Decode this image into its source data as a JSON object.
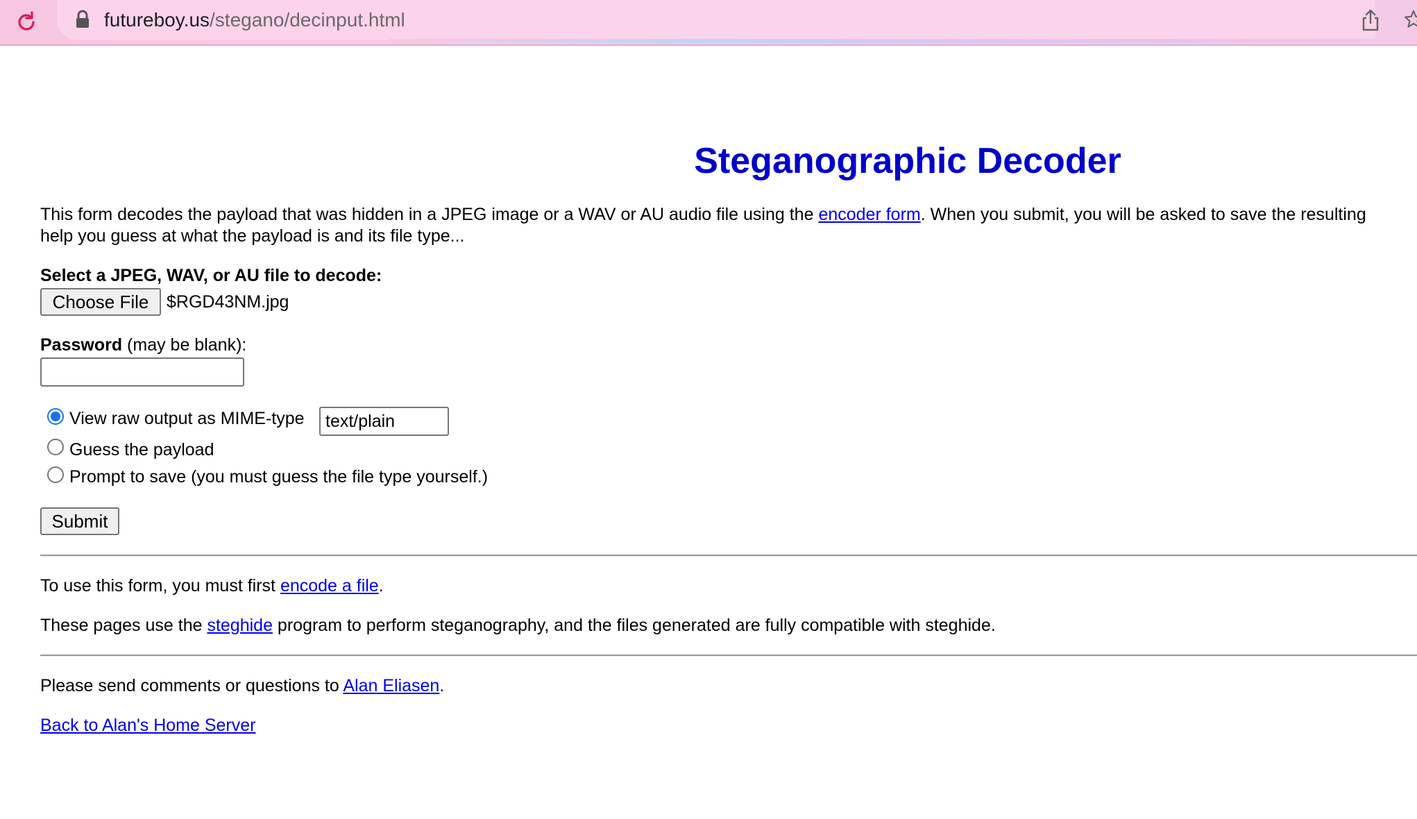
{
  "browser": {
    "url_host": "futureboy.us",
    "url_path": "/stegano/decinput.html"
  },
  "page": {
    "title": "Steganographic Decoder",
    "intro_part1": "This form decodes the payload that was hidden in a JPEG image or a WAV or AU audio file using the ",
    "intro_link": "encoder form",
    "intro_part2": ". When you submit, you will be asked to save the resulting",
    "intro_line2": "help you guess at what the payload is and its file type...",
    "file_label": "Select a JPEG, WAV, or AU file to decode:",
    "choose_file_label": "Choose File",
    "chosen_file_name": "$RGD43NM.jpg",
    "password_label_bold": "Password",
    "password_label_rest": " (may be blank):",
    "password_value": "",
    "options": [
      {
        "label": "View raw output as MIME-type",
        "checked": true
      },
      {
        "label": "Guess the payload",
        "checked": false
      },
      {
        "label": "Prompt to save (you must guess the file type yourself.)",
        "checked": false
      }
    ],
    "mime_value": "text/plain",
    "submit_label": "Submit",
    "use_part1": "To use this form, you must first ",
    "use_link": "encode a file",
    "use_part2": ".",
    "steghide_part1": "These pages use the ",
    "steghide_link": "steghide",
    "steghide_part2": " program to perform steganography, and the files generated are fully compatible with steghide.",
    "comments_part1": "Please send comments or questions to ",
    "comments_link": "Alan Eliasen",
    "comments_part2": ".",
    "back_link": "Back to Alan's Home Server"
  },
  "colors": {
    "title": "#0000c8",
    "link": "#0000ee",
    "radio_accent": "#1a73e8"
  }
}
